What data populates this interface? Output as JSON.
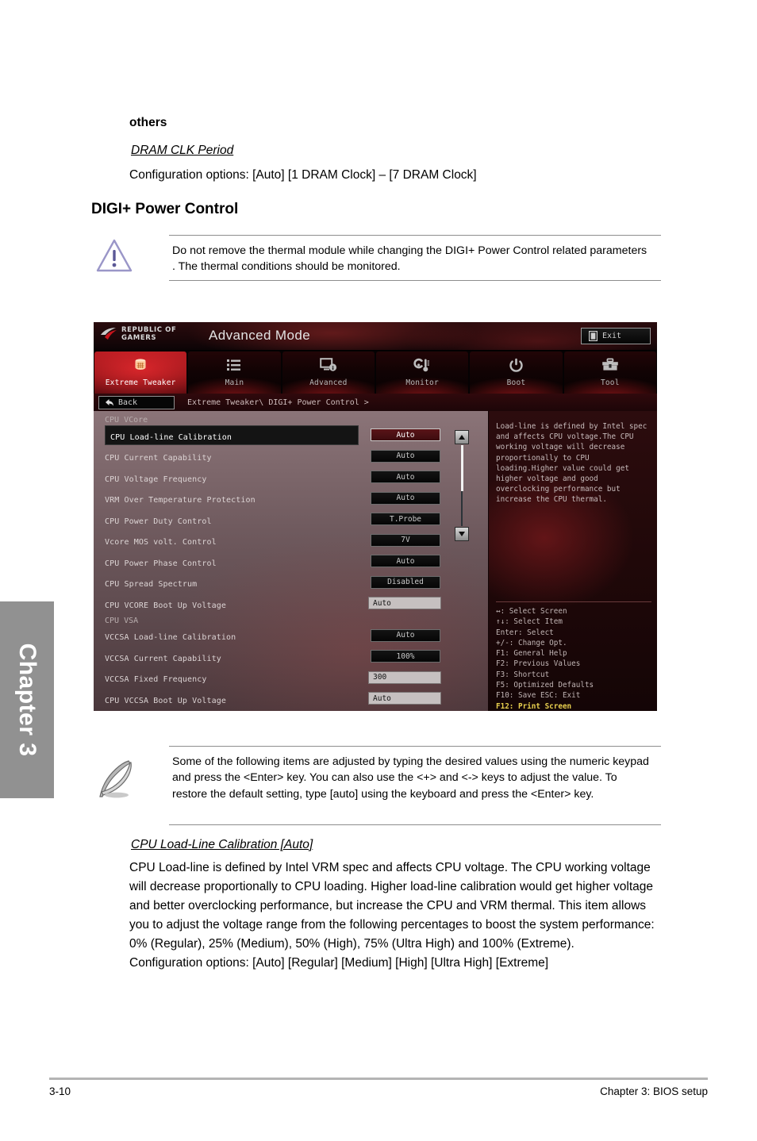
{
  "doc": {
    "others_heading": "others",
    "dram_clk_title": "DRAM CLK Period",
    "dram_clk_options": "Configuration options: [Auto] [1 DRAM Clock] – [7 DRAM Clock]",
    "digi_heading": "DIGI+ Power Control",
    "warning_text": "Do not remove the thermal module while changing the DIGI+ Power Control related parameters . The thermal conditions should be monitored.",
    "note_text": "Some of the following items are adjusted by typing the desired values using the numeric keypad and press the <Enter> key. You can also use the <+> and <-> keys to adjust the value. To restore the default setting, type [auto] using the keyboard and press the <Enter> key.",
    "llc_title": "CPU Load-Line Calibration [Auto]",
    "llc_body": "CPU Load-line is defined by Intel VRM spec and affects CPU voltage. The CPU working voltage will decrease proportionally to CPU loading. Higher load-line calibration would get higher voltage and better overclocking performance, but increase the CPU and VRM thermal. This item allows you to adjust the voltage range from the following percentages to boost the system performance: 0% (Regular), 25% (Medium), 50% (High), 75% (Ultra High) and 100% (Extreme).",
    "llc_options": "Configuration options: [Auto] [Regular] [Medium] [High] [Ultra High] [Extreme]",
    "chapter_tab": "Chapter 3",
    "footer_left": "3-10",
    "footer_right": "Chapter 3: BIOS setup"
  },
  "bios": {
    "brand_line1": "REPUBLIC OF",
    "brand_line2": "GAMERS",
    "mode_title": "Advanced Mode",
    "exit_label": "Exit",
    "tabs": [
      {
        "label": "Extreme Tweaker",
        "icon": "tweaker-icon",
        "active": true
      },
      {
        "label": "Main",
        "icon": "list-icon",
        "active": false
      },
      {
        "label": "Advanced",
        "icon": "monitor-info-icon",
        "active": false
      },
      {
        "label": "Monitor",
        "icon": "thermometer-icon",
        "active": false
      },
      {
        "label": "Boot",
        "icon": "power-icon",
        "active": false
      },
      {
        "label": "Tool",
        "icon": "toolbox-icon",
        "active": false
      }
    ],
    "back_label": "Back",
    "breadcrumb": "Extreme Tweaker\\ DIGI+ Power Control >",
    "groups": [
      {
        "type": "group",
        "label": "CPU VCore"
      },
      {
        "type": "item",
        "label": "CPU Load-line Calibration",
        "value": "Auto",
        "style": "button",
        "selected": true
      },
      {
        "type": "item",
        "label": "CPU Current Capability",
        "value": "Auto",
        "style": "button",
        "selected": false
      },
      {
        "type": "item",
        "label": "CPU Voltage Frequency",
        "value": "Auto",
        "style": "button",
        "selected": false
      },
      {
        "type": "item",
        "label": "VRM Over Temperature Protection",
        "value": "Auto",
        "style": "button",
        "selected": false
      },
      {
        "type": "item",
        "label": "CPU Power Duty Control",
        "value": "T.Probe",
        "style": "button",
        "selected": false
      },
      {
        "type": "item",
        "label": "Vcore MOS volt. Control",
        "value": "7V",
        "style": "button",
        "selected": false
      },
      {
        "type": "item",
        "label": "CPU Power Phase Control",
        "value": "Auto",
        "style": "button",
        "selected": false
      },
      {
        "type": "item",
        "label": "CPU Spread Spectrum",
        "value": "Disabled",
        "style": "button",
        "selected": false
      },
      {
        "type": "item",
        "label": "CPU VCORE Boot Up Voltage",
        "value": "Auto",
        "style": "field",
        "selected": false
      },
      {
        "type": "group",
        "label": "CPU VSA"
      },
      {
        "type": "item",
        "label": "VCCSA Load-line Calibration",
        "value": "Auto",
        "style": "button",
        "selected": false
      },
      {
        "type": "item",
        "label": "VCCSA Current Capability",
        "value": "100%",
        "style": "button",
        "selected": false
      },
      {
        "type": "item",
        "label": "VCCSA Fixed Frequency",
        "value": "300",
        "style": "field",
        "selected": false
      },
      {
        "type": "item",
        "label": "CPU VCCSA Boot Up Voltage",
        "value": "Auto",
        "style": "field",
        "selected": false
      }
    ],
    "help_text": "Load-line is defined by Intel spec and affects CPU voltage.The CPU working voltage will decrease proportionally to CPU loading.Higher value could get higher voltage and good overclocking performance but increase the CPU thermal.",
    "hotkeys": [
      {
        "text": "↔: Select Screen",
        "highlight": false
      },
      {
        "text": "↑↓: Select Item",
        "highlight": false
      },
      {
        "text": "Enter: Select",
        "highlight": false
      },
      {
        "text": "+/-: Change Opt.",
        "highlight": false
      },
      {
        "text": "F1: General Help",
        "highlight": false
      },
      {
        "text": "F2: Previous Values",
        "highlight": false
      },
      {
        "text": "F3: Shortcut",
        "highlight": false
      },
      {
        "text": "F5: Optimized Defaults",
        "highlight": false
      },
      {
        "text": "F10: Save  ESC: Exit",
        "highlight": false
      },
      {
        "text": "F12: Print Screen",
        "highlight": true
      }
    ],
    "colors": {
      "accent_red": "#a8161c",
      "panel_dark": "#1b0709",
      "value_field": "#c6c0c0"
    }
  }
}
